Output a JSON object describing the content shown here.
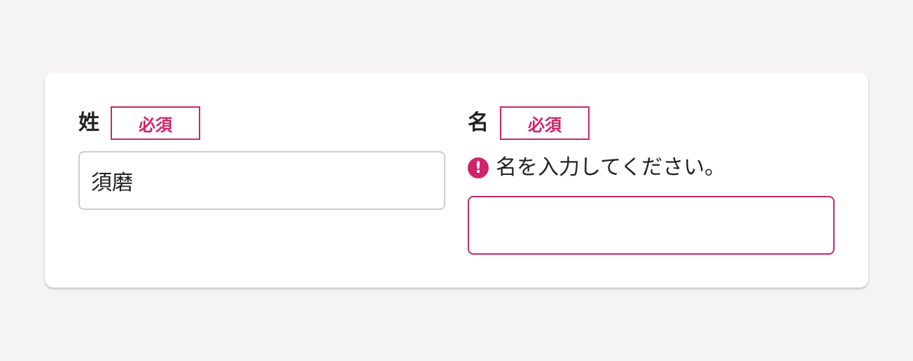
{
  "form": {
    "last_name": {
      "label": "姓",
      "required_badge": "必須",
      "value": "須磨"
    },
    "first_name": {
      "label": "名",
      "required_badge": "必須",
      "error_message": "名を入力してください。",
      "value": ""
    }
  },
  "icons": {
    "error": "exclamation-circle-icon"
  },
  "colors": {
    "background": "#f5f4f3",
    "card": "#ffffff",
    "accent_error": "#d0246a",
    "text": "#23221f",
    "input_border": "#cfcdca"
  }
}
